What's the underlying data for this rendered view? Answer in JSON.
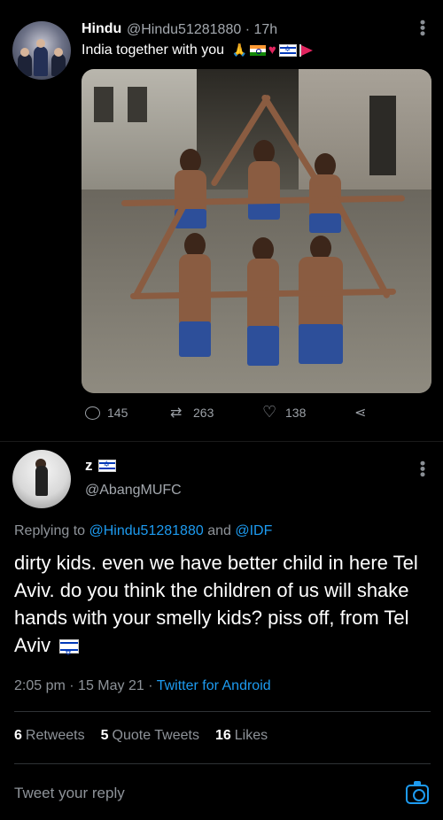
{
  "tweet1": {
    "display_name": "Hindu",
    "handle": "@Hindu51281880",
    "time": "17h",
    "text": "India together with you",
    "emojis": [
      "folded-hands",
      "india-flag",
      "red-heart",
      "israel-flag",
      "red-flag"
    ],
    "reply_count": "145",
    "retweet_count": "263",
    "like_count": "138"
  },
  "tweet2": {
    "display_name": "z",
    "name_emoji": "israel-flag",
    "handle": "@AbangMUFC",
    "replying_prefix": "Replying to",
    "replying_to_1": "@Hindu51281880",
    "replying_and": "and",
    "replying_to_2": "@IDF",
    "body": "dirty kids. even we have better child in here Tel Aviv. do you think the children of us will shake hands with your smelly kids? piss off, from Tel Aviv",
    "time": "2:05 pm",
    "date": "15 May 21",
    "source": "Twitter for Android",
    "retweets_count": "6",
    "retweets_label": "Retweets",
    "quotes_count": "5",
    "quotes_label": "Quote Tweets",
    "likes_count": "16",
    "likes_label": "Likes"
  },
  "reply_bar": {
    "placeholder": "Tweet your reply"
  },
  "colors": {
    "background": "#000000",
    "link": "#1d9bf0",
    "secondary_text": "#8e9399"
  }
}
